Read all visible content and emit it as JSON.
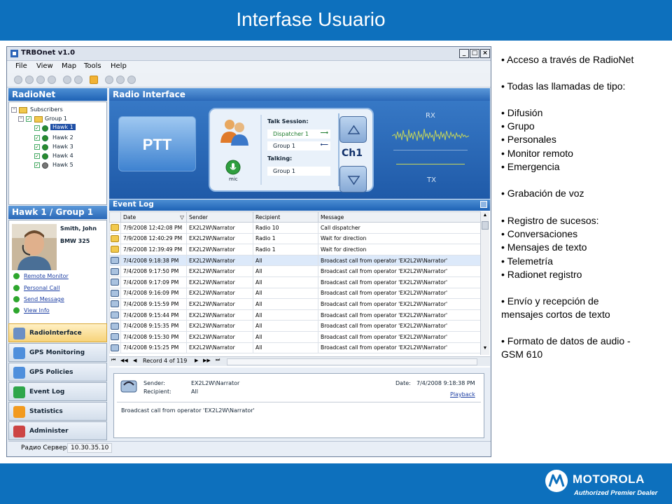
{
  "slide": {
    "title": "Interfase Usuario"
  },
  "brand": {
    "wordmark": "MOTOROLA",
    "tagline": "Authorized Premier Dealer",
    "bar_color": "#0d70bd"
  },
  "window": {
    "title": "TRBOnet v1.0",
    "controls": {
      "minimize": "_",
      "maximize": "□",
      "close": "×"
    },
    "menu": [
      "File",
      "View",
      "Map",
      "Tools",
      "Help"
    ],
    "radionet_header": "RadioNet",
    "tree": {
      "root": "Subscribers",
      "group": "Group 1",
      "members": [
        "Hawk 1",
        "Hawk 2",
        "Hawk 3",
        "Hawk 4",
        "Hawk 5"
      ],
      "selected": "Hawk 1"
    },
    "user_panel": {
      "header": "Hawk 1 / Group 1",
      "name": "Smith, John",
      "vehicle": "BMW 325",
      "links": [
        "Remote Monitor",
        "Personal Call",
        "Send Message",
        "View Info"
      ]
    },
    "nav": [
      {
        "label": "RadioInterface",
        "icon": "radio-interface-icon",
        "color": "#ffe29a"
      },
      {
        "label": "GPS Monitoring",
        "icon": "gps-monitoring-icon",
        "color": "#4f8fdc"
      },
      {
        "label": "GPS Policies",
        "icon": "gps-policies-icon",
        "color": "#4f8fdc"
      },
      {
        "label": "Event Log",
        "icon": "event-log-icon",
        "color": "#2fa64a"
      },
      {
        "label": "Statistics",
        "icon": "statistics-icon",
        "color": "#f29a1f"
      },
      {
        "label": "Administer",
        "icon": "administer-icon",
        "color": "#c44"
      }
    ],
    "status": {
      "label": "Радио Сервер:",
      "value": "10.30.35.10"
    },
    "radio_interface": {
      "header": "Radio Interface",
      "ptt": "PTT",
      "mic": "mic",
      "talk_session_label": "Talk Session:",
      "talk_session_items": [
        "Dispatcher 1",
        "Group 1"
      ],
      "talking_label": "Talking:",
      "talking_value": "Group 1",
      "channel": "Ch1",
      "rx": "RX",
      "tx": "TX"
    },
    "event_log": {
      "header": "Event Log",
      "columns": [
        "Date",
        "Sender",
        "Recipient",
        "Message"
      ],
      "rows": [
        {
          "date": "7/9/2008 12:42:08 PM",
          "sender": "EX2L2W\\Narrator",
          "recipient": "Radio 10",
          "message": "Call dispatcher",
          "kind": "folder"
        },
        {
          "date": "7/9/2008 12:40:29 PM",
          "sender": "EX2L2W\\Narrator",
          "recipient": "Radio 1",
          "message": "Wait for direction",
          "kind": "folder"
        },
        {
          "date": "7/9/2008 12:39:49 PM",
          "sender": "EX2L2W\\Narrator",
          "recipient": "Radio 1",
          "message": "Wait for direction",
          "kind": "folder"
        },
        {
          "date": "7/4/2008 9:18:38 PM",
          "sender": "EX2L2W\\Narrator",
          "recipient": "All",
          "message": "Broadcast call from operator 'EX2L2W\\Narrator'",
          "kind": "call"
        },
        {
          "date": "7/4/2008 9:17:50 PM",
          "sender": "EX2L2W\\Narrator",
          "recipient": "All",
          "message": "Broadcast call from operator 'EX2L2W\\Narrator'",
          "kind": "call"
        },
        {
          "date": "7/4/2008 9:17:09 PM",
          "sender": "EX2L2W\\Narrator",
          "recipient": "All",
          "message": "Broadcast call from operator 'EX2L2W\\Narrator'",
          "kind": "call"
        },
        {
          "date": "7/4/2008 9:16:09 PM",
          "sender": "EX2L2W\\Narrator",
          "recipient": "All",
          "message": "Broadcast call from operator 'EX2L2W\\Narrator'",
          "kind": "call"
        },
        {
          "date": "7/4/2008 9:15:59 PM",
          "sender": "EX2L2W\\Narrator",
          "recipient": "All",
          "message": "Broadcast call from operator 'EX2L2W\\Narrator'",
          "kind": "call"
        },
        {
          "date": "7/4/2008 9:15:44 PM",
          "sender": "EX2L2W\\Narrator",
          "recipient": "All",
          "message": "Broadcast call from operator 'EX2L2W\\Narrator'",
          "kind": "call"
        },
        {
          "date": "7/4/2008 9:15:35 PM",
          "sender": "EX2L2W\\Narrator",
          "recipient": "All",
          "message": "Broadcast call from operator 'EX2L2W\\Narrator'",
          "kind": "call"
        },
        {
          "date": "7/4/2008 9:15:30 PM",
          "sender": "EX2L2W\\Narrator",
          "recipient": "All",
          "message": "Broadcast call from operator 'EX2L2W\\Narrator'",
          "kind": "call"
        },
        {
          "date": "7/4/2008 9:15:25 PM",
          "sender": "EX2L2W\\Narrator",
          "recipient": "All",
          "message": "Broadcast call from operator 'EX2L2W\\Narrator'",
          "kind": "call"
        }
      ],
      "selected_row": 3,
      "record_nav": "Record 4 of 119"
    },
    "detail": {
      "sender_label": "Sender:",
      "sender_value": "EX2L2W\\Narrator",
      "recipient_label": "Recipient:",
      "recipient_value": "All",
      "date_label": "Date:",
      "date_value": "7/4/2008 9:18:38 PM",
      "playback": "Playback",
      "message": "Broadcast call from operator 'EX2L2W\\Narrator'"
    }
  },
  "bullets": [
    "• Acceso a través de RadioNet",
    "•  Todas las llamadas de tipo:",
    "•  Difusión",
    "•  Grupo",
    "•  Personales",
    "•  Monitor remoto",
    "•  Emergencia",
    "•  Grabación de voz",
    "•  Registro de sucesos:",
    "•  Conversaciones",
    "•  Mensajes de texto",
    "•  Telemetría",
    "•  Radionet registro",
    "•  Envío y recepción de",
    "mensajes cortos de texto",
    "•  Formato de datos de audio -",
    "GSM 610"
  ]
}
